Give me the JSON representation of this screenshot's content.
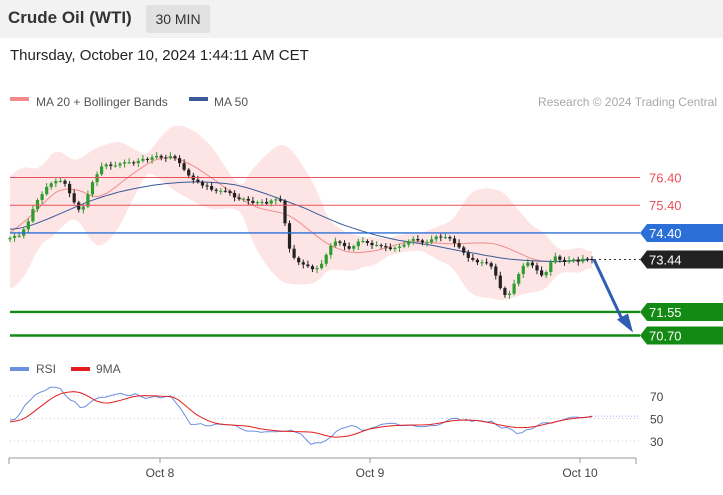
{
  "header": {
    "title": "Crude Oil (WTI)",
    "interval": "30 MIN",
    "datetime": "Thursday, October 10, 2024 1:44:11 AM CET"
  },
  "legend": {
    "ma20_label": "MA 20 + Bollinger Bands",
    "ma50_label": "MA 50",
    "credit": "Research © 2024 Trading Central",
    "rsi_label": "RSI",
    "rsi_ma_label": "9MA"
  },
  "colors": {
    "ma20": "#f28b8b",
    "band": "#fde2e2",
    "ma50": "#3a5a98",
    "resistance": "#e8505b",
    "pivot": "#2c6fd8",
    "support": "#138a13",
    "current": "#222222",
    "rsi": "#6d8fe0",
    "rsi_ma": "#e21d1d",
    "candle_up": "#2e9c2e",
    "candle_down": "#222222",
    "arrow": "#2e5db3"
  },
  "chart_data": {
    "type": "candlestick",
    "price_range": [
      70.55,
      77.9
    ],
    "x_tick_labels": [
      "Oct 8",
      "Oct 9",
      "Oct 10"
    ],
    "levels": [
      {
        "label": "76.40",
        "value": 76.4,
        "role": "resistance"
      },
      {
        "label": "75.40",
        "value": 75.4,
        "role": "resistance"
      },
      {
        "label": "74.40",
        "value": 74.4,
        "role": "pivot"
      },
      {
        "label": "73.44",
        "value": 73.44,
        "role": "current"
      },
      {
        "label": "71.55",
        "value": 71.55,
        "role": "support"
      },
      {
        "label": "70.70",
        "value": 70.7,
        "role": "support"
      }
    ],
    "target_arrow": {
      "from": 73.44,
      "to": 70.7
    },
    "closes": [
      74.22,
      74.29,
      74.3,
      74.53,
      74.82,
      75.26,
      75.59,
      75.8,
      76.06,
      76.19,
      76.27,
      76.28,
      76.17,
      75.83,
      75.5,
      75.24,
      75.35,
      75.79,
      76.23,
      76.52,
      76.8,
      76.87,
      76.82,
      76.83,
      76.9,
      76.95,
      76.95,
      76.92,
      77.0,
      77.07,
      77.04,
      77.13,
      77.18,
      77.12,
      77.1,
      77.17,
      77.1,
      76.92,
      76.68,
      76.47,
      76.32,
      76.24,
      76.11,
      76.09,
      75.96,
      75.92,
      75.92,
      75.91,
      75.84,
      75.68,
      75.62,
      75.63,
      75.56,
      75.48,
      75.51,
      75.52,
      75.46,
      75.57,
      75.61,
      75.56,
      74.75,
      73.83,
      73.5,
      73.34,
      73.26,
      73.2,
      73.09,
      73.13,
      73.29,
      73.61,
      73.93,
      74.09,
      74.04,
      73.92,
      73.83,
      73.92,
      74.09,
      74.11,
      74.04,
      73.96,
      73.96,
      73.93,
      73.88,
      73.82,
      73.86,
      73.91,
      73.98,
      74.11,
      74.18,
      74.13,
      74.05,
      74.06,
      74.17,
      74.27,
      74.24,
      74.25,
      74.2,
      74.03,
      73.88,
      73.69,
      73.5,
      73.43,
      73.34,
      73.34,
      73.31,
      73.19,
      72.86,
      72.41,
      72.16,
      72.21,
      72.57,
      72.92,
      73.21,
      73.33,
      73.23,
      73.05,
      72.87,
      72.99,
      73.34,
      73.55,
      73.43,
      73.35,
      73.42,
      73.44,
      73.36,
      73.47,
      73.46,
      73.44
    ],
    "ma20": [
      74.41,
      74.59,
      74.78,
      74.98,
      75.22,
      75.48,
      75.7,
      75.89,
      75.98,
      75.98,
      75.96,
      75.87,
      75.74,
      75.71,
      75.77,
      75.91,
      76.1,
      76.29,
      76.47,
      76.64,
      76.81,
      76.96,
      77.06,
      77.11,
      77.12,
      77.07,
      76.99,
      76.87,
      76.73,
      76.57,
      76.41,
      76.24,
      76.06,
      75.88,
      75.72,
      75.56,
      75.43,
      75.32,
      75.25,
      75.2,
      75.16,
      75.09,
      74.99,
      74.83,
      74.64,
      74.44,
      74.26,
      74.08,
      73.94,
      73.84,
      73.75,
      73.7,
      73.69,
      73.71,
      73.73,
      73.78,
      73.84,
      73.92,
      73.99,
      74.04,
      74.07,
      74.08,
      74.07,
      74.05,
      74.03,
      74.02,
      74.01,
      74.01,
      74.02,
      74.03,
      74.04,
      74.04,
      74.02,
      73.97,
      73.89,
      73.79,
      73.68,
      73.57,
      73.47,
      73.41,
      73.37,
      73.36,
      73.37,
      73.38,
      73.4,
      73.42,
      73.43,
      73.44
    ],
    "ma50": [
      74.53,
      74.56,
      74.63,
      74.72,
      74.84,
      74.96,
      75.09,
      75.22,
      75.35,
      75.48,
      75.59,
      75.69,
      75.78,
      75.87,
      75.94,
      76.0,
      76.06,
      76.11,
      76.15,
      76.19,
      76.21,
      76.23,
      76.24,
      76.24,
      76.23,
      76.21,
      76.18,
      76.14,
      76.07,
      75.99,
      75.89,
      75.79,
      75.68,
      75.57,
      75.46,
      75.35,
      75.22,
      75.08,
      74.95,
      74.82,
      74.7,
      74.6,
      74.5,
      74.41,
      74.32,
      74.25,
      74.18,
      74.12,
      74.08,
      74.03,
      73.99,
      73.94,
      73.88,
      73.82,
      73.76,
      73.71,
      73.66,
      73.6,
      73.55,
      73.5,
      73.46,
      73.43,
      73.41,
      73.39,
      73.38,
      73.37,
      73.37,
      73.38,
      73.4,
      73.42,
      73.45
    ],
    "rsi_axis": {
      "ticks": [
        70,
        50,
        30
      ],
      "range": [
        20,
        85
      ]
    },
    "rsi": [
      48.6,
      49.2,
      54.3,
      62.0,
      66.2,
      71.0,
      73.3,
      74.8,
      77.7,
      77.7,
      76.8,
      70.8,
      66.5,
      64.8,
      59.7,
      60.4,
      64.4,
      67.2,
      68.8,
      68.9,
      70.4,
      71.3,
      72.4,
      70.9,
      70.4,
      72.1,
      69.8,
      67.8,
      68.8,
      69.6,
      68.2,
      69.4,
      70.1,
      64.4,
      58.8,
      51.9,
      44.8,
      44.8,
      45.5,
      43.6,
      43.5,
      45.1,
      44.9,
      44.4,
      44.3,
      43.7,
      41.1,
      39.0,
      38.8,
      38.7,
      37.6,
      38.3,
      38.2,
      38.3,
      38.5,
      38.6,
      39.8,
      37.6,
      36.3,
      31.4,
      27.0,
      28.6,
      28.3,
      30.6,
      33.6,
      38.4,
      41.0,
      42.2,
      43.8,
      42.8,
      39.8,
      39.5,
      41.5,
      42.7,
      44.8,
      45.3,
      45.8,
      45.2,
      43.7,
      43.8,
      44.1,
      43.0,
      42.7,
      43.0,
      43.8,
      43.7,
      45.4,
      47.7,
      50.0,
      50.1,
      48.5,
      49.1,
      47.5,
      48.3,
      47.9,
      46.8,
      47.6,
      44.1,
      41.4,
      42.1,
      40.2,
      36.7,
      37.3,
      40.1,
      40.7,
      43.3,
      46.0,
      46.3,
      45.9,
      47.3,
      48.3,
      50.1,
      51.2,
      51.2,
      50.6,
      51.2,
      52.1
    ],
    "rsi_ma": [
      47.0,
      47.8,
      48.9,
      51.9,
      55.6,
      59.6,
      63.5,
      67.3,
      70.4,
      72.5,
      73.5,
      73.9,
      73.1,
      70.9,
      68.0,
      65.2,
      63.9,
      63.8,
      64.9,
      66.2,
      67.7,
      69.2,
      70.0,
      70.4,
      70.2,
      70.1,
      69.7,
      69.6,
      69.0,
      66.3,
      62.1,
      57.6,
      53.6,
      50.6,
      48.1,
      46.3,
      45.2,
      44.6,
      44.2,
      43.9,
      43.6,
      43.1,
      42.0,
      40.9,
      40.1,
      39.5,
      39.0,
      38.7,
      38.5,
      38.4,
      38.3,
      38.1,
      37.7,
      36.7,
      35.2,
      34.0,
      33.4,
      33.7,
      34.4,
      35.7,
      37.5,
      39.4,
      40.9,
      41.8,
      42.6,
      43.2,
      43.7,
      43.9,
      44.1,
      44.2,
      44.2,
      44.3,
      44.6,
      45.2,
      46.1,
      47.1,
      48.0,
      48.5,
      48.7,
      48.6,
      48.3,
      47.5,
      46.6,
      45.6,
      44.4,
      43.4,
      42.5,
      42.0,
      41.9,
      42.1,
      42.6,
      43.7,
      44.9,
      46.1,
      47.4,
      48.6,
      49.5,
      50.1,
      50.6,
      51.1,
      51.6
    ]
  }
}
